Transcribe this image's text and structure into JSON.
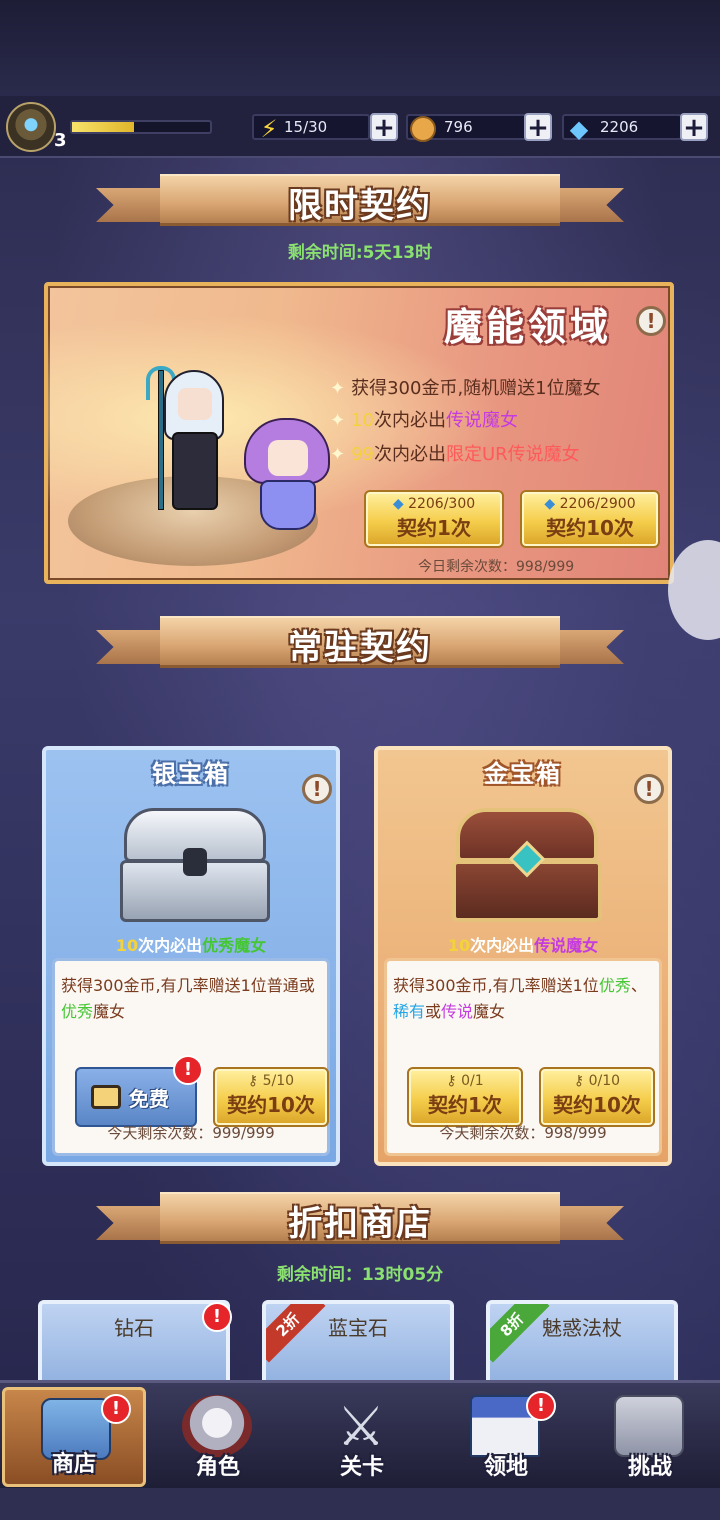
{
  "player": {
    "level": "3",
    "exp_fraction": 0.45
  },
  "resources": [
    {
      "icon": "lightning-icon",
      "value": "15/30"
    },
    {
      "icon": "coin-icon",
      "value": "796"
    },
    {
      "icon": "diamond-icon",
      "value": "2206"
    }
  ],
  "limited": {
    "header": "限时契约",
    "timer": "剩余时间:5天13时",
    "title": "魔能领域",
    "perk1": "获得300金币,随机赠送1位魔女",
    "perk2_num": "10",
    "perk2_text": "次内必出",
    "perk2_highlight": "传说魔女",
    "perk3_num": "99",
    "perk3_text": "次内必出",
    "perk3_highlight": "限定UR传说魔女",
    "btn1_cost": "2206/300",
    "btn1_label": "契约1次",
    "btn2_cost": "2206/2900",
    "btn2_label": "契约10次",
    "remain": "今日剩余次数：998/999"
  },
  "standing": {
    "header": "常驻契约",
    "silver": {
      "title": "银宝箱",
      "note_num": "10",
      "note_text": "次内必出",
      "note_highlight": "优秀魔女",
      "desc_a": "获得300金币,有几率赠送1位普通或",
      "desc_b": "优秀",
      "desc_c": "魔女",
      "free_label": "免费",
      "btn_cost": "5/10",
      "btn_label": "契约10次",
      "remain": "今天剩余次数：999/999"
    },
    "gold": {
      "title": "金宝箱",
      "note_num": "10",
      "note_text": "次内必出",
      "note_highlight": "传说魔女",
      "desc_a": "获得300金币,有几率赠送1位",
      "desc_b": "优秀",
      "desc_sep": "、",
      "desc_c": "稀有",
      "desc_d": "或",
      "desc_e": "传说",
      "desc_f": "魔女",
      "btn1_cost": "0/1",
      "btn1_label": "契约1次",
      "btn2_cost": "0/10",
      "btn2_label": "契约10次",
      "remain": "今天剩余次数：998/999"
    }
  },
  "shop": {
    "header": "折扣商店",
    "timer": "剩余时间：13时05分",
    "items": [
      {
        "name": "钻石",
        "discount": ""
      },
      {
        "name": "蓝宝石",
        "discount": "2折"
      },
      {
        "name": "魅惑法杖",
        "discount": "8折"
      }
    ]
  },
  "nav": [
    {
      "label": "商店",
      "icon": "shop-icon"
    },
    {
      "label": "角色",
      "icon": "character-icon"
    },
    {
      "label": "关卡",
      "icon": "crossed-swords-icon"
    },
    {
      "label": "领地",
      "icon": "castle-icon"
    },
    {
      "label": "挑战",
      "icon": "challenge-icon"
    }
  ],
  "colors": {
    "highlight_purple": "#c43ce0",
    "highlight_red": "#ff5a5a",
    "highlight_green": "#45c634",
    "timer_green": "#8ae070"
  }
}
